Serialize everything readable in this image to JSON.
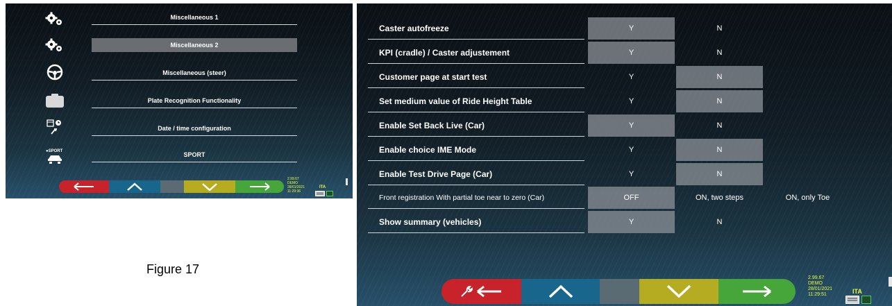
{
  "left_screen": {
    "menu": [
      {
        "icon": "gears-icon",
        "label": "Miscellaneous 1",
        "selected": false
      },
      {
        "icon": "gears-icon",
        "label": "Miscellaneous 2",
        "selected": true
      },
      {
        "icon": "steering-wheel-icon",
        "label": "Miscellaneous (steer)",
        "selected": false
      },
      {
        "icon": "camera-icon",
        "label": "Plate Recognition Functionality",
        "selected": false
      },
      {
        "icon": "calendar-clock-icon",
        "label": "Date / time configuration",
        "selected": false
      },
      {
        "icon": "sport-car-icon",
        "label": "SPORT",
        "selected": false
      }
    ],
    "sport_icon_text": "SPORT",
    "status": {
      "version": "2.99.67",
      "mode": "DEMO",
      "date": "28/01/2021",
      "time": "11:29:36"
    },
    "language": "ITA"
  },
  "right_screen": {
    "rows": [
      {
        "label": "Caster autofreeze",
        "options": [
          "Y",
          "N"
        ],
        "selected": 0,
        "bold": true
      },
      {
        "label": "KPI (cradle) / Caster adjustement",
        "options": [
          "Y",
          "N"
        ],
        "selected": 0,
        "bold": true
      },
      {
        "label": "Customer page at start test",
        "options": [
          "Y",
          "N"
        ],
        "selected": 1,
        "bold": true
      },
      {
        "label": "Set medium value of Ride Height Table",
        "options": [
          "Y",
          "N"
        ],
        "selected": 1,
        "bold": true
      },
      {
        "label": "Enable Set Back Live (Car)",
        "options": [
          "Y",
          "N"
        ],
        "selected": 0,
        "bold": true
      },
      {
        "label": "Enable choice IME Mode",
        "options": [
          "Y",
          "N"
        ],
        "selected": 1,
        "bold": true
      },
      {
        "label": "Enable Test Drive Page (Car)",
        "options": [
          "Y",
          "N"
        ],
        "selected": 1,
        "bold": true
      },
      {
        "label": "Front registration With partial toe near to zero (Car)",
        "options": [
          "OFF",
          "ON, two steps",
          "ON, only Toe"
        ],
        "selected": 0,
        "bold": false
      },
      {
        "label": "Show summary (vehicles)",
        "options": [
          "Y",
          "N"
        ],
        "selected": 0,
        "bold": true
      }
    ],
    "status": {
      "version": "2.99.67",
      "mode": "DEMO",
      "date": "28/01/2021",
      "time": "11:29:51"
    },
    "language": "ITA"
  },
  "nav": {
    "colors": {
      "back": "#c8232a",
      "up": "#18668c",
      "middle": "#5b6b73",
      "down": "#b6ac22",
      "next": "#47a63a"
    }
  },
  "figure_caption": "Figure 17"
}
